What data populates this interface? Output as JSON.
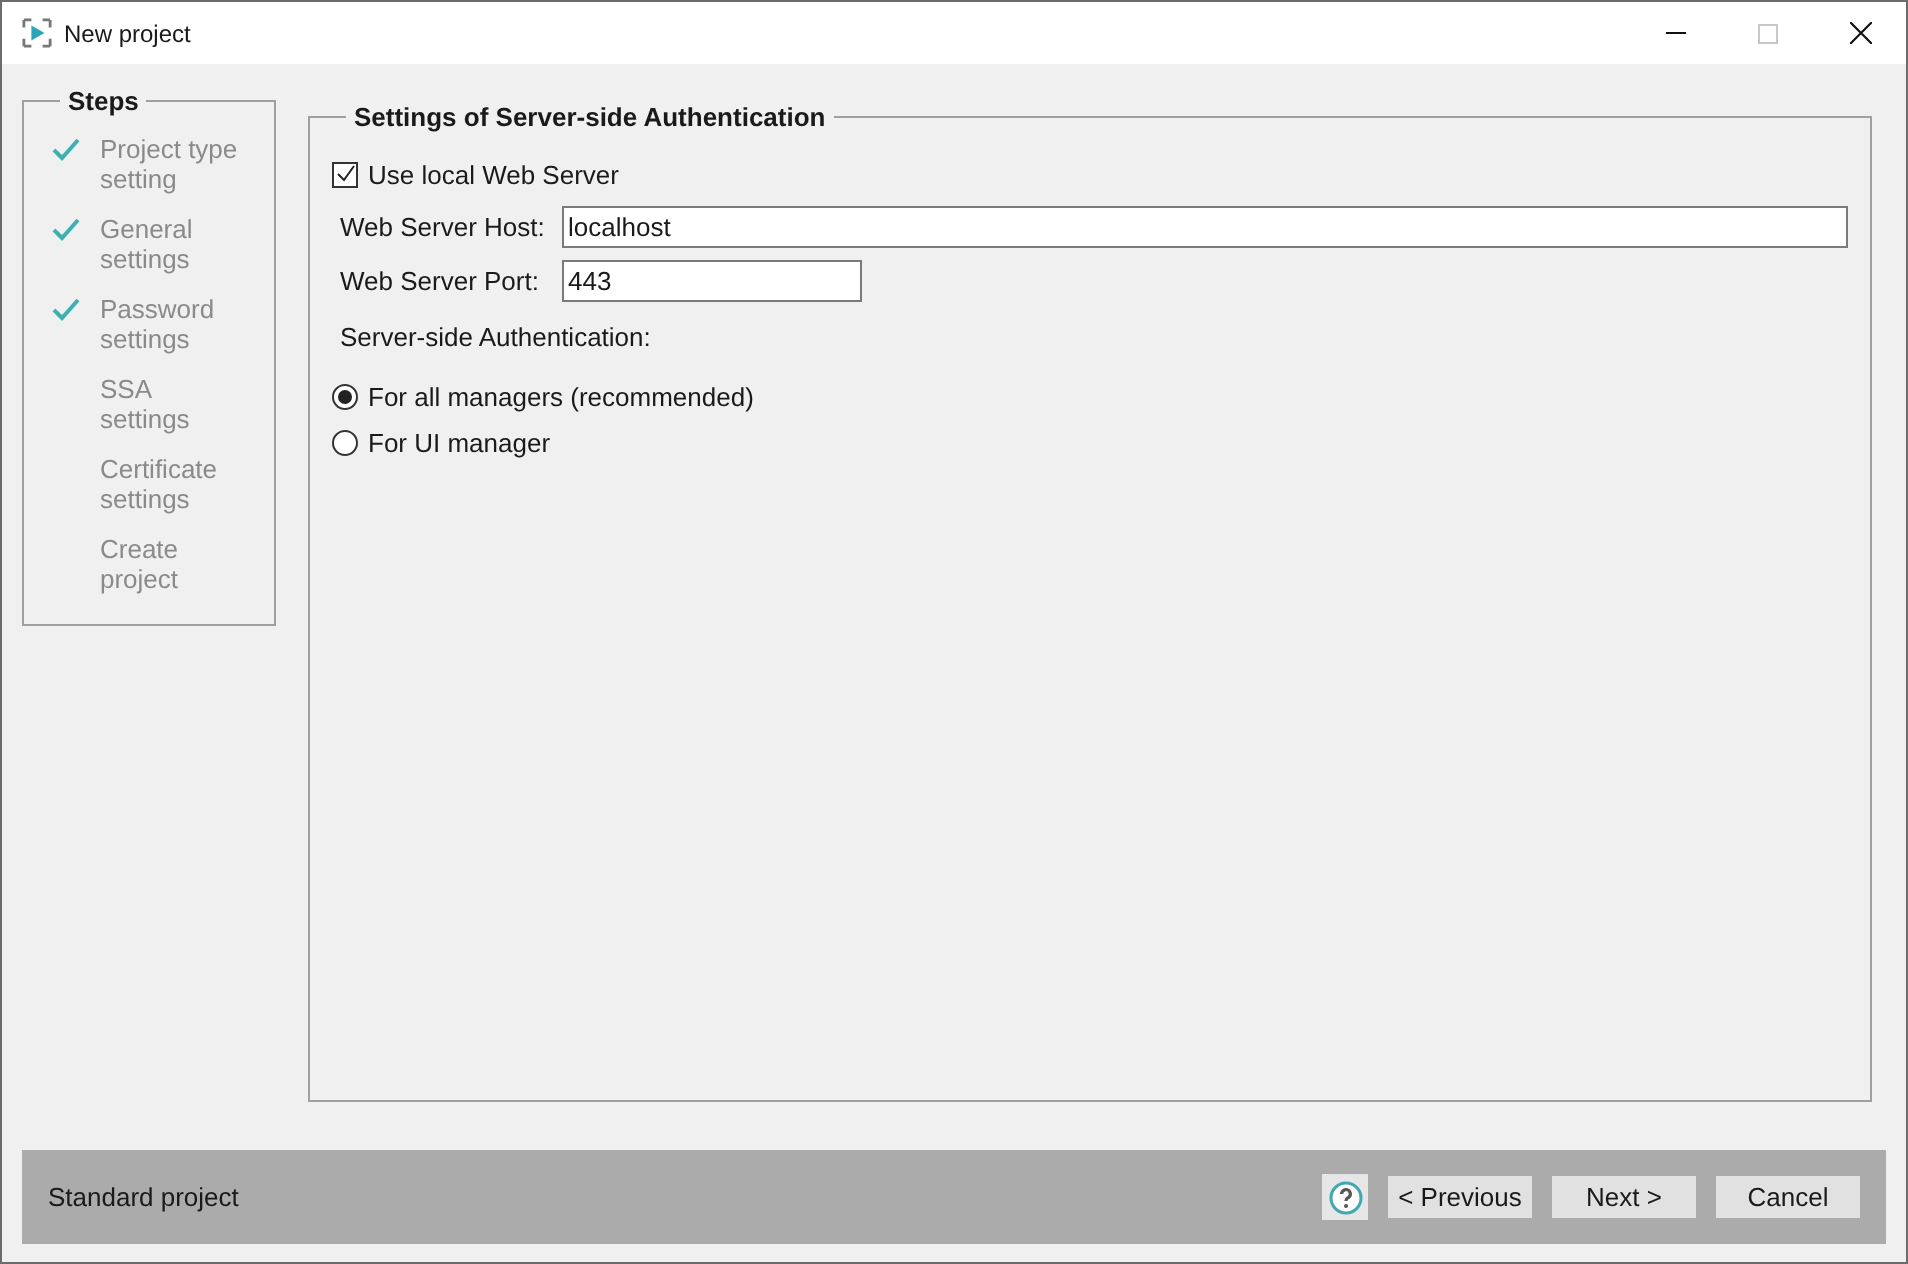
{
  "window": {
    "title": "New project",
    "maximize_disabled": true
  },
  "steps": {
    "title": "Steps",
    "items": [
      {
        "label": "Project type setting",
        "completed": true
      },
      {
        "label": "General settings",
        "completed": true
      },
      {
        "label": "Password settings",
        "completed": true
      },
      {
        "label": "SSA settings",
        "completed": false
      },
      {
        "label": "Certificate settings",
        "completed": false
      },
      {
        "label": "Create project",
        "completed": false
      }
    ]
  },
  "settings": {
    "title": "Settings of Server-side Authentication",
    "use_local": {
      "label": "Use local Web Server",
      "checked": true
    },
    "host": {
      "label": "Web Server Host:",
      "value": "localhost"
    },
    "port": {
      "label": "Web Server Port:",
      "value": "443"
    },
    "auth_label": "Server-side Authentication:",
    "options": [
      {
        "label": "For all managers (recommended)",
        "selected": true
      },
      {
        "label": "For UI manager",
        "selected": false
      }
    ]
  },
  "footer": {
    "status": "Standard project",
    "buttons": [
      "< Previous",
      "Next >",
      "Cancel"
    ]
  }
}
